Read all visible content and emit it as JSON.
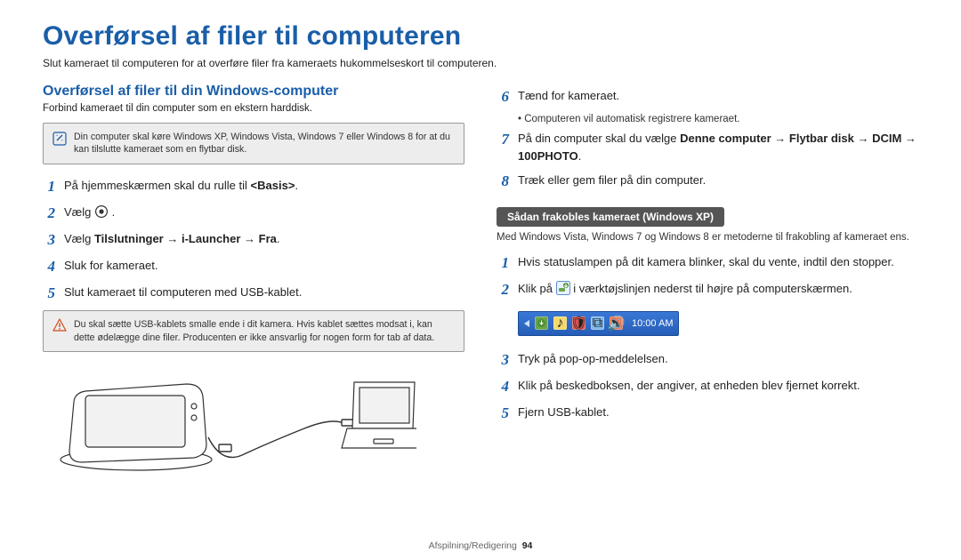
{
  "title": "Overførsel af filer til computeren",
  "intro": "Slut kameraet til computeren for at overføre filer fra kameraets hukommelseskort til computeren.",
  "left": {
    "heading": "Overførsel af filer til din Windows-computer",
    "sub": "Forbind kameraet til din computer som en ekstern harddisk.",
    "note": "Din computer skal køre Windows XP, Windows Vista, Windows 7 eller Windows 8 for at du kan tilslutte kameraet som en flytbar disk.",
    "step1_a": "På hjemmeskærmen skal du rulle til ",
    "step1_b": "<Basis>",
    "step1_c": ".",
    "step2": "Vælg ",
    "step3_a": "Vælg ",
    "step3_b": "Tilslutninger → i-Launcher → Fra",
    "step3_c": ".",
    "step4": "Sluk for kameraet.",
    "step5": "Slut kameraet til computeren med USB-kablet.",
    "warn": "Du skal sætte USB-kablets smalle ende i dit kamera. Hvis kablet sættes modsat i, kan dette ødelægge dine filer. Producenten er ikke ansvarlig for nogen form for tab af data."
  },
  "right": {
    "step6": "Tænd for kameraet.",
    "step6_sub": "•  Computeren vil automatisk registrere kameraet.",
    "step7_a": "På din computer skal du vælge ",
    "step7_b": "Denne computer → Flytbar disk → DCIM → 100PHOTO",
    "step7_c": ".",
    "step8": "Træk eller gem filer på din computer.",
    "disc_heading": "Sådan frakobles kameraet (Windows XP)",
    "disc_note": "Med Windows Vista, Windows 7 og Windows 8 er metoderne til frakobling af kameraet ens.",
    "dstep1": "Hvis statuslampen på dit kamera blinker, skal du vente, indtil den stopper.",
    "dstep2_a": "Klik på ",
    "dstep2_b": " i værktøjslinjen nederst til højre på computerskærmen.",
    "clock": "10:00 AM",
    "dstep3": "Tryk på pop-op-meddelelsen.",
    "dstep4": "Klik på beskedboksen, der angiver, at enheden blev fjernet korrekt.",
    "dstep5": "Fjern USB-kablet."
  },
  "nums": {
    "n1": "1",
    "n2": "2",
    "n3": "3",
    "n4": "4",
    "n5": "5",
    "n6": "6",
    "n7": "7",
    "n8": "8"
  },
  "footer_label": "Afspilning/Redigering",
  "footer_page": "94"
}
